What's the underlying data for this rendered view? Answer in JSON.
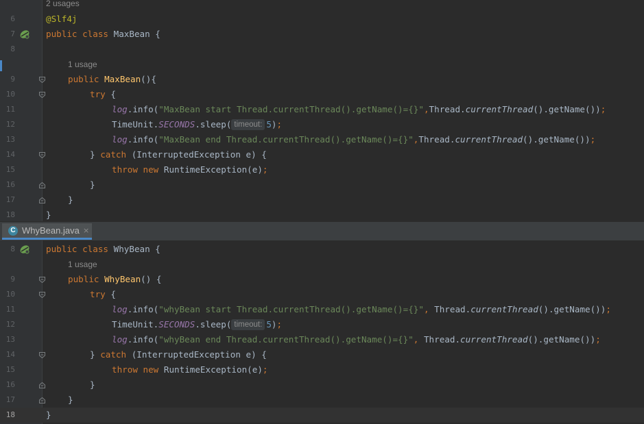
{
  "pane1": {
    "usages_top": "2 usages",
    "usage_ctor": "1 usage",
    "ln": [
      "6",
      "7",
      "8",
      "9",
      "10",
      "11",
      "12",
      "13",
      "14",
      "15",
      "16",
      "17",
      "18"
    ],
    "annotation": "@Slf4j",
    "kw_public": "public",
    "kw_class": "class",
    "class_name": "MaxBean",
    "ctor_name": "MaxBean",
    "kw_try": "try",
    "kw_catch": "catch",
    "kw_throw": "throw",
    "kw_new": "new",
    "log_field": "log",
    "info_call": ".info(",
    "str_start": "\"MaxBean start Thread.currentThread().getName()={}\"",
    "str_end": "\"MaxBean end Thread.currentThread().getName()={}\"",
    "thread_cls": "Thread.",
    "current_thread": "currentThread",
    "get_name_tail": "().getName())",
    "timeunit": "TimeUnit.",
    "seconds": "SECONDS",
    "sleep_call": ".sleep(",
    "hint_timeout": "timeout:",
    "num_5": "5",
    "catch_args": "(InterruptedException e) {",
    "runtime_ex": "RuntimeException(e)",
    "brace_open": "{",
    "brace_close": "}",
    "ctor_paren": "(){",
    "paren_close": ")",
    "semi": ";",
    "comma": ","
  },
  "tab": {
    "icon_letter": "C",
    "label": "WhyBean.java",
    "close": "×"
  },
  "pane2": {
    "usage_ctor": "1 usage",
    "ln": [
      "8",
      "9",
      "10",
      "11",
      "12",
      "13",
      "14",
      "15",
      "16",
      "17",
      "18"
    ],
    "kw_public": "public",
    "kw_class": "class",
    "class_name": "WhyBean",
    "ctor_name": "WhyBean",
    "kw_try": "try",
    "kw_catch": "catch",
    "kw_throw": "throw",
    "kw_new": "new",
    "log_field": "log",
    "info_call": ".info(",
    "str_start": "\"whyBean start Thread.currentThread().getName()={}\"",
    "str_end": "\"whyBean end Thread.currentThread().getName()={}\"",
    "thread_cls": " Thread.",
    "current_thread": "currentThread",
    "get_name_tail": "().getName())",
    "timeunit": "TimeUnit.",
    "seconds": "SECONDS",
    "sleep_call": ".sleep(",
    "hint_timeout": "timeout:",
    "num_5": "5",
    "catch_args": "(InterruptedException e) {",
    "runtime_ex": "RuntimeException(e)",
    "brace_open": "{",
    "brace_close": "}",
    "ctor_paren": "() {",
    "paren_close": ")",
    "semi": ";",
    "comma": ","
  },
  "colors": {
    "background": "#2b2b2b",
    "keyword": "#cc7832",
    "string": "#6a8759",
    "method_decl": "#ffc66d",
    "annotation": "#bbb529",
    "field": "#9876aa",
    "number": "#6897bb",
    "text": "#a9b7c6"
  },
  "icons": [
    "spring-bean-icon",
    "fold-marker-icon",
    "java-class-icon",
    "close-icon"
  ]
}
